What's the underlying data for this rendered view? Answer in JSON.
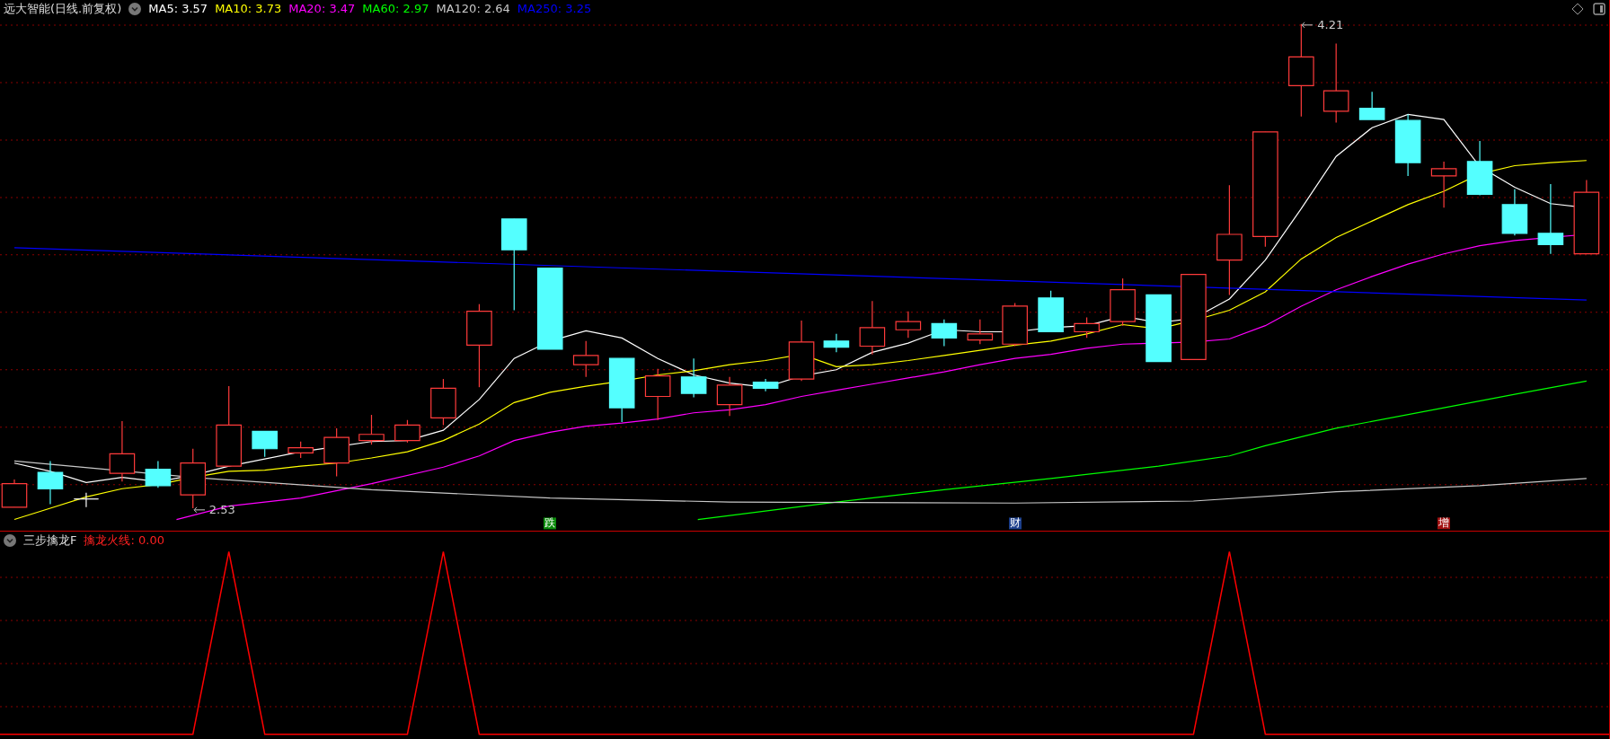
{
  "title": "远大智能(日线.前复权)",
  "moving_averages": [
    {
      "label": "MA5: 3.57",
      "color": "#ffffff"
    },
    {
      "label": "MA10: 3.73",
      "color": "#ffff00"
    },
    {
      "label": "MA20: 3.47",
      "color": "#ff00ff"
    },
    {
      "label": "MA60: 2.97",
      "color": "#00ff00"
    },
    {
      "label": "MA120: 2.64",
      "color": "#c8c8c8"
    },
    {
      "label": "MA250: 3.25",
      "color": "#0000ff"
    }
  ],
  "price_labels": [
    {
      "text": "4.21"
    },
    {
      "text": "2.53"
    }
  ],
  "event_markers": [
    {
      "text": "跌",
      "color": "#0a8a0a"
    },
    {
      "text": "财",
      "color": "#1c3f8c"
    },
    {
      "text": "增",
      "color": "#a01010"
    }
  ],
  "indicator": {
    "name": "三步擒龙F",
    "value_label": "擒龙火线: 0.00"
  }
}
